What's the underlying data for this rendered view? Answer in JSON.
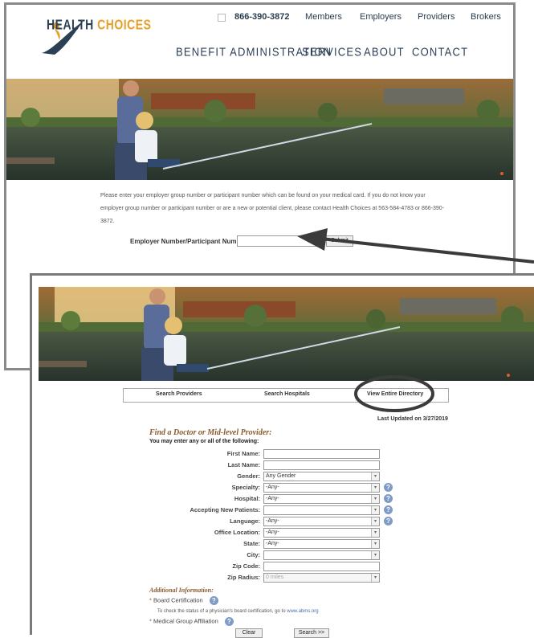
{
  "header": {
    "phone": "866-390-3872",
    "top_links": [
      "Members",
      "Employers",
      "Providers",
      "Brokers"
    ],
    "logo_text_main": "HEALTH ",
    "logo_text_accent": "CHOICES",
    "nav": [
      "BENEFIT ADMINISTRATION",
      "SERVICES",
      "ABOUT",
      "CONTACT"
    ]
  },
  "employer_lookup": {
    "instructions": "Please enter your employer group number or participant number which can be found on your medical card. If you do not know your employer group number or participant number or are a new or potential client, please contact Health Choices at 563-584-4783 or 866-390-3872.",
    "label": "Employer Number/Participant Number:",
    "input_value": "",
    "submit_label": "Submit"
  },
  "directory": {
    "tabs": [
      "Search Providers",
      "Search Hospitals",
      "View Entire Directory"
    ],
    "last_updated": "Last Updated on 3/27/2019",
    "title": "Find a Doctor or Mid-level Provider:",
    "subtitle": "You may enter any or all of the following:",
    "fields": [
      {
        "label": "First Name:",
        "value": ""
      },
      {
        "label": "Last Name:",
        "value": ""
      },
      {
        "label": "Gender:",
        "value": "Any Gender"
      },
      {
        "label": "Specialty:",
        "value": "-Any-"
      },
      {
        "label": "Hospital:",
        "value": "-Any-"
      },
      {
        "label": "Accepting New Patients:",
        "value": ""
      },
      {
        "label": "Language:",
        "value": "-Any-"
      },
      {
        "label": "Office Location:",
        "value": "-Any-"
      },
      {
        "label": "State:",
        "value": "-Any-"
      },
      {
        "label": "City:",
        "value": ""
      },
      {
        "label": "Zip Code:",
        "value": ""
      },
      {
        "label": "Zip Radius:",
        "value": "0 miles"
      }
    ],
    "additional_title": "Additional Information:",
    "board_cert_label": "Board Certification",
    "board_note": "To check the status of a physician's board certification, go to ",
    "board_link": "www.abms.org",
    "medical_group_label": "Medical Group Affiliation",
    "clear_label": "Clear",
    "search_label": "Search >>"
  }
}
